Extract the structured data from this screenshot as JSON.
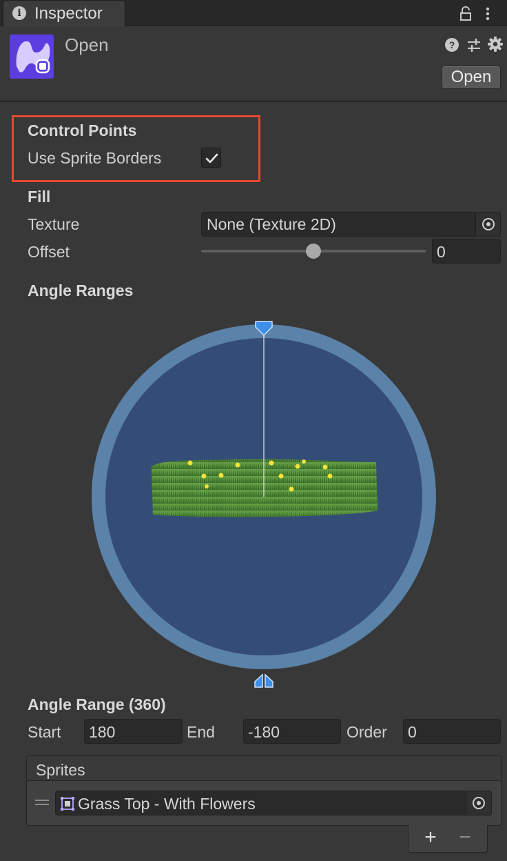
{
  "tab": {
    "label": "Inspector",
    "info_icon": "info-icon"
  },
  "header": {
    "title": "Open",
    "open_button": "Open"
  },
  "control_points": {
    "heading": "Control Points",
    "use_sprite_borders_label": "Use Sprite Borders",
    "use_sprite_borders": true
  },
  "fill": {
    "heading": "Fill",
    "texture_label": "Texture",
    "texture_value": "None (Texture 2D)",
    "offset_label": "Offset",
    "offset_value": "0",
    "offset_slider_fraction": 0.5
  },
  "angle_ranges": {
    "heading": "Angle Ranges"
  },
  "angle_range": {
    "heading": "Angle Range (360)",
    "start_label": "Start",
    "start_value": "180",
    "end_label": "End",
    "end_value": "-180",
    "order_label": "Order",
    "order_value": "0"
  },
  "sprites": {
    "heading": "Sprites",
    "items": [
      {
        "name": "Grass Top - With Flowers"
      }
    ],
    "add_label": "+",
    "remove_label": "−"
  },
  "colors": {
    "background": "#383838",
    "highlight": "#e5482f",
    "ring": "#5b82a8",
    "disc": "#344d77",
    "handle": "#3d8fe8",
    "asset_icon": "#5b3ee0"
  }
}
